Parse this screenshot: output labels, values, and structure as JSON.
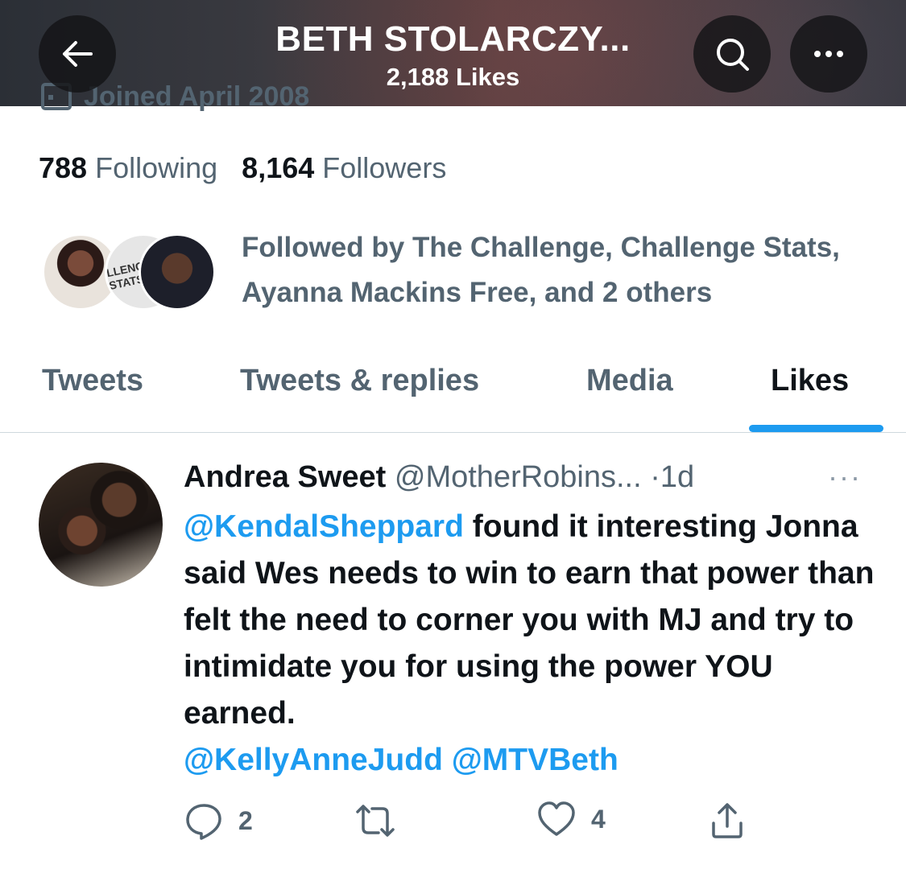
{
  "header": {
    "title": "BETH STOLARCZY...",
    "subtitle": "2,188 Likes"
  },
  "profile": {
    "joined": "Joined April 2008",
    "following_count": "788",
    "following_label": "Following",
    "followers_count": "8,164",
    "followers_label": "Followers",
    "followed_by": "Followed by The Challenge, Challenge Stats, Ayanna Mackins Free, and 2 others",
    "avatar2_text": "LLENGE STATS"
  },
  "tabs": [
    "Tweets",
    "Tweets & replies",
    "Media",
    "Likes"
  ],
  "tweet": {
    "name": "Andrea Sweet",
    "handle": "@MotherRobins...",
    "separator": "·",
    "time": "1d",
    "mention1": "@KendalSheppard",
    "text": " found it interesting Jonna said Wes needs to win to earn that power than felt the need to corner you with MJ and try to intimidate you for using the power YOU earned.",
    "mention2": "@KellyAnneJudd",
    "mention3": "@MTVBeth",
    "replies": "2",
    "retweets": "",
    "likes": "4",
    "more": "···"
  },
  "colors": {
    "accent": "#1d9bf0",
    "secondary_text": "#536471",
    "primary_text": "#0f1419"
  },
  "icons": {
    "back": "arrow-left-icon",
    "search": "search-icon",
    "more": "more-icon",
    "reply": "reply-icon",
    "retweet": "retweet-icon",
    "like": "heart-icon",
    "share": "share-icon"
  }
}
